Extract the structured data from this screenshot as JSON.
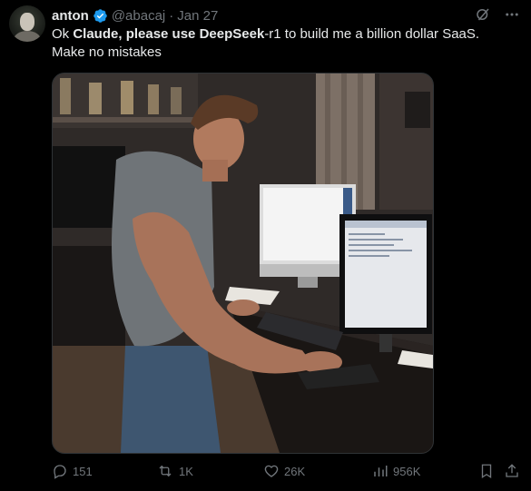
{
  "tweet": {
    "author_name": "anton",
    "handle": "@abacaj",
    "separator": "·",
    "date": "Jan 27",
    "text_parts": [
      "Ok ",
      "Claude, please use DeepSeek",
      "-r1 to build me a billion dollar SaaS. Make no mistakes"
    ]
  },
  "icons": {
    "verified": "verified-badge-icon",
    "grok": "grok-icon",
    "more": "more-icon",
    "reply": "reply-icon",
    "retweet": "retweet-icon",
    "like": "like-icon",
    "views": "views-icon",
    "bookmark": "bookmark-icon",
    "share": "share-icon"
  },
  "actions": {
    "replies": "151",
    "retweets": "1K",
    "likes": "26K",
    "views": "956K"
  },
  "colors": {
    "background": "#000000",
    "text": "#e7e9ea",
    "muted": "#71767b",
    "verified": "#1d9bf0"
  }
}
